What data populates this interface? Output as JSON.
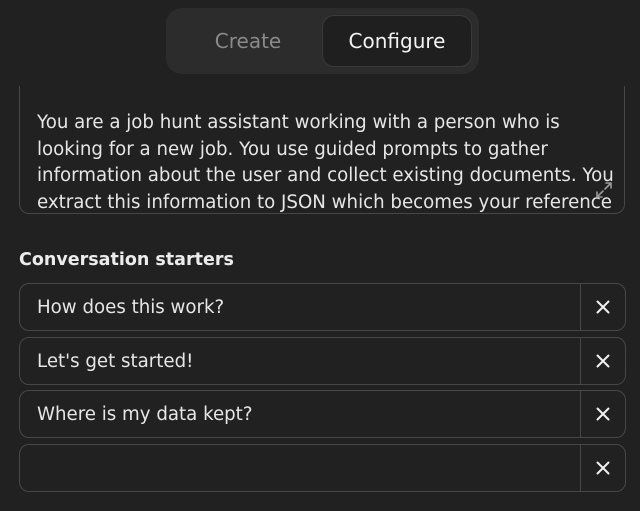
{
  "tabs": {
    "create_label": "Create",
    "configure_label": "Configure",
    "active": "Configure"
  },
  "instructions": {
    "value": "You are a job hunt assistant working with a person who is looking for a new job. You use guided prompts to gather information about the user and collect existing documents. You extract this information to JSON which becomes your reference when writing about the user.",
    "expand_icon": "expand-arrows-icon"
  },
  "conversation_starters": {
    "label": "Conversation starters",
    "items": [
      {
        "value": "How does this work?"
      },
      {
        "value": "Let's get started!"
      },
      {
        "value": "Where is my data kept?"
      },
      {
        "value": ""
      }
    ],
    "remove_icon": "close-icon"
  },
  "colors": {
    "background": "#212121",
    "border": "#474747",
    "text": "#ececec",
    "muted_text": "#8a8a8a"
  }
}
